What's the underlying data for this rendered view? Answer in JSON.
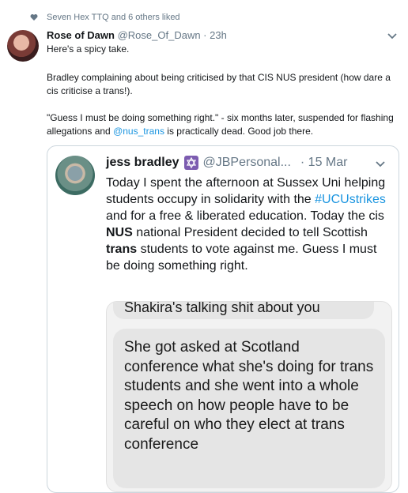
{
  "liked": {
    "text": "Seven Hex TTQ and 6 others liked",
    "icon": "heart-icon"
  },
  "tweet": {
    "name": "Rose of Dawn",
    "handle": "@Rose_Of_Dawn · 23h",
    "line1": "Here's a spicy take.",
    "para2": "Bradley complaining about being criticised by that CIS NUS president (how dare a cis criticise a trans!).",
    "para3_a": "\"Guess I must be doing something right.\" - six months later, suspended for flashing allegations and ",
    "para3_mention": "@nus_trans",
    "para3_b": " is practically dead. Good job there.",
    "menu_icon": "chevron-down-icon"
  },
  "quote": {
    "name": "jess bradley",
    "badge_icon": "star-of-david-icon",
    "handle": "@JBPersonal...",
    "date": "· 15 Mar",
    "body_1": "Today I spent the afternoon at Sussex Uni helping students occupy in solidarity with the ",
    "hashtag": "#UCUstrikes",
    "body_2": " and for a free & liberated education. Today the cis ",
    "bold_1": "NUS",
    "body_3": " national President decided to tell Scottish ",
    "bold_2": "trans",
    "body_4": " students to vote against me. Guess I must be doing something right.",
    "image_top_text": "Shakira's talking shit about you",
    "image_main_text": "She got asked at Scotland conference what she's doing for trans students and she went into a whole speech on how people have to be careful on who they elect at trans conference"
  }
}
